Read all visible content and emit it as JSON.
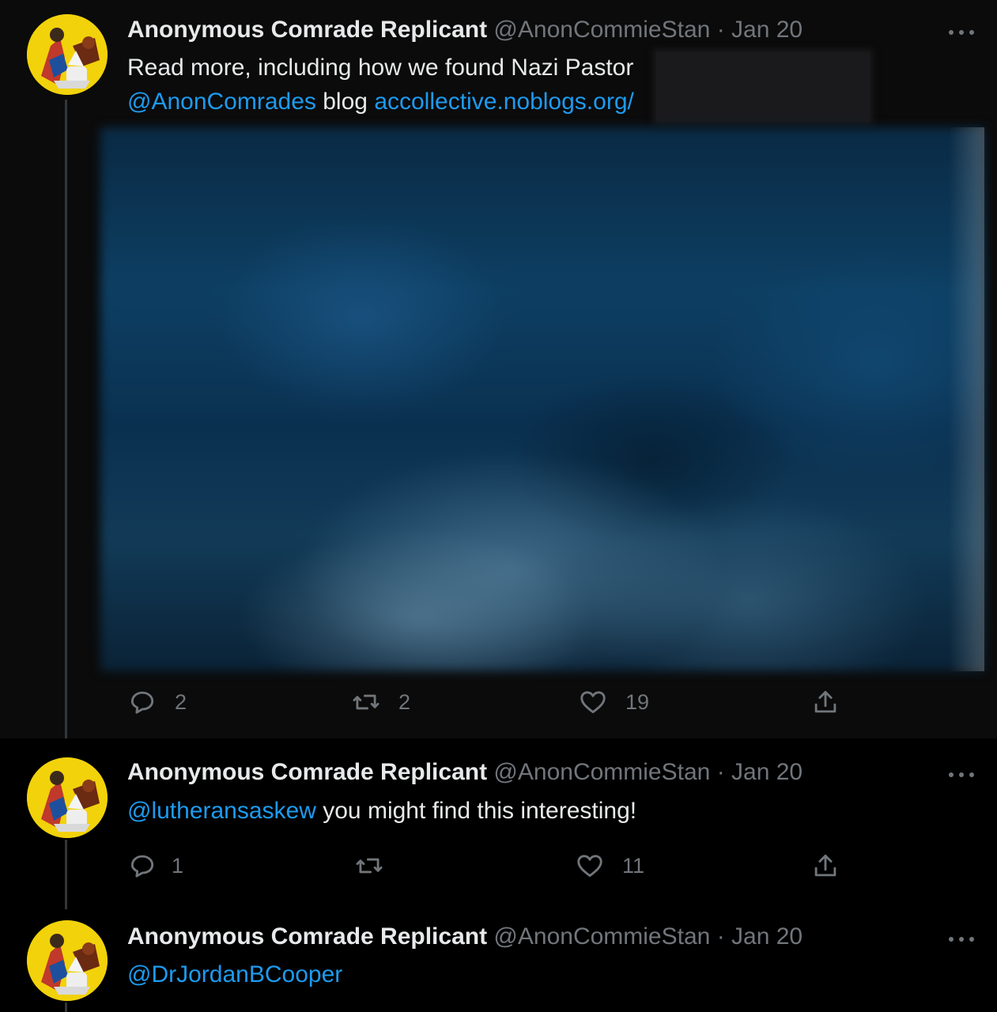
{
  "tweets": [
    {
      "author_name": "Anonymous Comrade Replicant",
      "handle": "@AnonCommieStan",
      "separator": "·",
      "date": "Jan 20",
      "text_line1": "Read more, including how we found Nazi Pastor",
      "mention": "@AnonComrades",
      "word_blog": "blog",
      "url": "accollective.noblogs.org/",
      "actions": {
        "replies": "2",
        "retweets": "2",
        "likes": "19"
      }
    },
    {
      "author_name": "Anonymous Comrade Replicant",
      "handle": "@AnonCommieStan",
      "separator": "·",
      "date": "Jan 20",
      "mention": "@lutheransaskew",
      "text_rest": "you might find this interesting!",
      "actions": {
        "replies": "1",
        "retweets": "",
        "likes": "11"
      }
    },
    {
      "author_name": "Anonymous Comrade Replicant",
      "handle": "@AnonCommieStan",
      "separator": "·",
      "date": "Jan 20",
      "mention": "@DrJordanBCooper"
    }
  ],
  "icons": {
    "reply": "reply-icon",
    "retweet": "retweet-icon",
    "like": "heart-icon",
    "share": "share-icon",
    "more": "more-icon"
  },
  "colors": {
    "background": "#000000",
    "link": "#1d9bf0",
    "secondary_text": "#71767b",
    "primary_text": "#e7e9ea"
  }
}
